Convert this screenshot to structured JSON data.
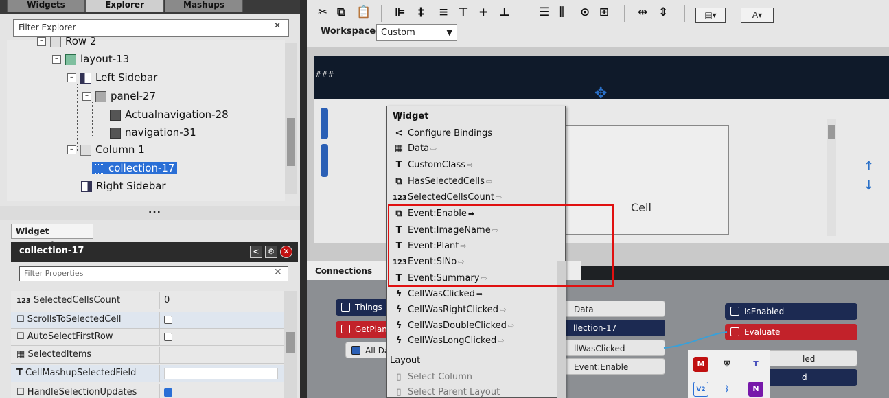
{
  "tabs": [
    "Widgets",
    "Explorer",
    "Mashups"
  ],
  "explorer": {
    "filter_placeholder": "Filter Explorer",
    "tree": [
      {
        "label": "Row 2"
      },
      {
        "label": "layout-13"
      },
      {
        "label": "Left Sidebar"
      },
      {
        "label": "panel-27"
      },
      {
        "label": "Actualnavigation-28"
      },
      {
        "label": "navigation-31"
      },
      {
        "label": "Column 1"
      },
      {
        "label": "collection-17"
      },
      {
        "label": "Right Sidebar"
      }
    ]
  },
  "widget_properties": {
    "header": "Widget Properties",
    "selected": "collection-17",
    "filter_placeholder": "Filter Properties",
    "rows": [
      {
        "icon": "123",
        "name": "SelectedCellsCount",
        "value": "0"
      },
      {
        "icon": "",
        "name": "ScrollsToSelectedCell",
        "value": ""
      },
      {
        "icon": "",
        "name": "AutoSelectFirstRow",
        "value": ""
      },
      {
        "icon": "",
        "name": "SelectedItems",
        "value": ""
      },
      {
        "icon": "T",
        "name": "CellMashupSelectedField",
        "value": ""
      },
      {
        "icon": "",
        "name": "HandleSelectionUpdates",
        "value": ""
      }
    ]
  },
  "toolbar": {
    "workspace_label": "Workspace",
    "workspace_value": "Custom"
  },
  "canvas": {
    "band_text": "###",
    "cell_label": "Cell"
  },
  "connections": {
    "tab_label": "Connections",
    "pills": {
      "things": "Things_M",
      "getplant": "GetPlant",
      "alldata": "All Da",
      "data": "Data",
      "collection": "llection-17",
      "cellwasclicked": "llWasClicked",
      "eventenable": "Event:Enable",
      "isenabled": "IsEnabled",
      "evaluate": "Evaluate",
      "led1": "led",
      "led2": "d"
    }
  },
  "menu": {
    "items": [
      {
        "icon": "",
        "label": "Widget"
      },
      {
        "icon": "<",
        "label": "Configure Bindings"
      },
      {
        "icon": "grid",
        "label": "Data"
      },
      {
        "icon": "T",
        "label": "CustomClass"
      },
      {
        "icon": "",
        "label": "HasSelectedCells"
      },
      {
        "icon": "123",
        "label": "SelectedCellsCount"
      },
      {
        "icon": "",
        "label": "Event:Enable"
      },
      {
        "icon": "T",
        "label": "Event:ImageName"
      },
      {
        "icon": "T",
        "label": "Event:Plant"
      },
      {
        "icon": "123",
        "label": "Event:SlNo"
      },
      {
        "icon": "T",
        "label": "Event:Summary"
      },
      {
        "icon": "bolt",
        "label": "CellWasClicked"
      },
      {
        "icon": "bolt",
        "label": "CellWasRightClicked"
      },
      {
        "icon": "bolt",
        "label": "CellWasDoubleClicked"
      },
      {
        "icon": "bolt",
        "label": "CellWasLongClicked"
      },
      {
        "icon": "",
        "label": "Layout"
      },
      {
        "icon": "",
        "label": "Select Column"
      },
      {
        "icon": "",
        "label": "Select Parent Layout"
      }
    ]
  },
  "colors": {
    "accent": "#2a6fd6",
    "highlight": "#e01010",
    "navy": "#1c2a52"
  }
}
